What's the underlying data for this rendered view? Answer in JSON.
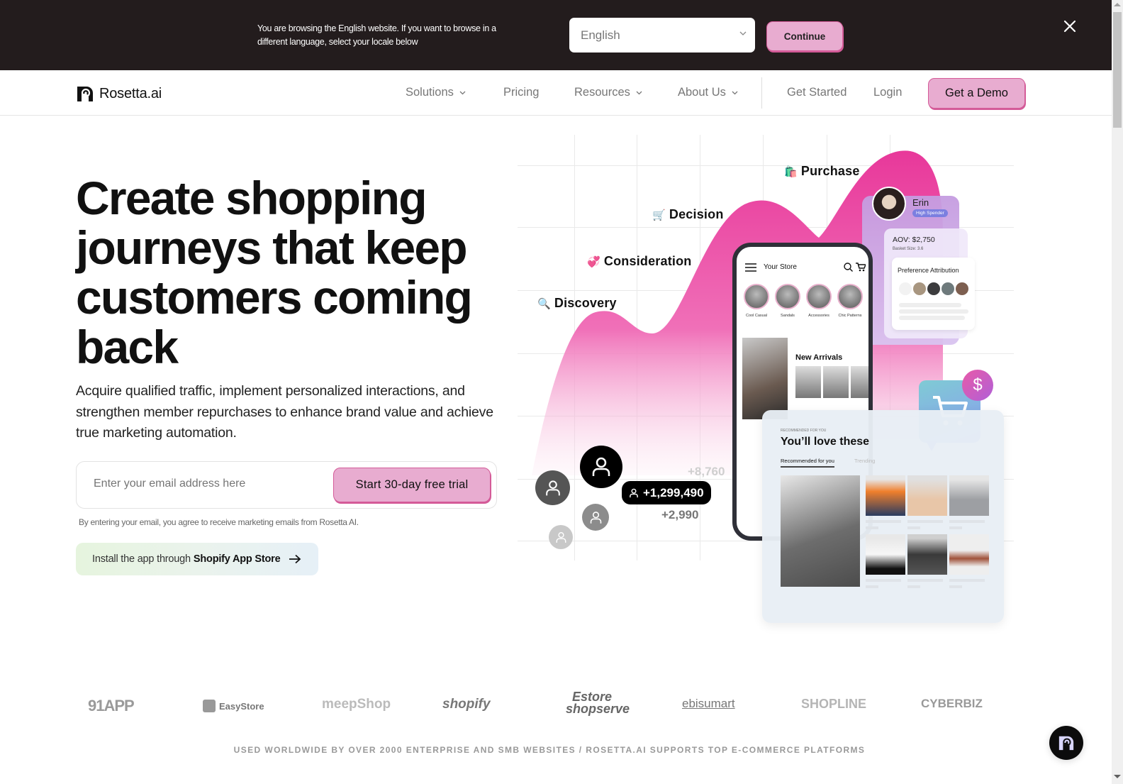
{
  "banner": {
    "message": "You are browsing the English website. If you want to browse in a different language, select your locale below",
    "locale_selected": "English",
    "continue_label": "Continue",
    "close_icon": "close-icon"
  },
  "nav": {
    "brand": "Rosetta.ai",
    "items": [
      {
        "label": "Solutions",
        "has_dropdown": true
      },
      {
        "label": "Pricing",
        "has_dropdown": false
      },
      {
        "label": "Resources",
        "has_dropdown": true
      },
      {
        "label": "About Us",
        "has_dropdown": true
      }
    ],
    "get_started": "Get Started",
    "login": "Login",
    "demo": "Get a Demo"
  },
  "hero": {
    "headline": "Create shopping journeys that keep customers coming back",
    "subtext": "Acquire qualified traffic, implement personalized interactions, and strengthen member repurchases to enhance brand value and achieve true marketing automation.",
    "email_placeholder": "Enter your email address here",
    "trial_label": "Start 30-day free trial",
    "consent": "By entering your email, you agree to receive marketing emails from Rosetta AI.",
    "shopify_prefix": "Install the app through",
    "shopify_link": "Shopify App Store"
  },
  "illustration": {
    "stages": [
      {
        "label": "Discovery",
        "icon": "🔍"
      },
      {
        "label": "Consideration",
        "icon": "💞"
      },
      {
        "label": "Decision",
        "icon": "🛒"
      },
      {
        "label": "Purchase",
        "icon": "🛍️"
      }
    ],
    "phone": {
      "store_title": "Your Store",
      "categories": [
        "Cool Casual",
        "Sandals",
        "Accessories",
        "Chic Patterns"
      ],
      "new_arrivals": "New Arrivals"
    },
    "profile": {
      "name": "Erin",
      "badge": "High Spender",
      "aov": "AOV: $2,750",
      "basket": "Basket Size: 3.6",
      "preference_title": "Preference Attribution",
      "swatches": [
        "#f2f2f2",
        "#a89680",
        "#3c3c3e",
        "#6e7a7c",
        "#7d5f50"
      ]
    },
    "recommendations": {
      "subtitle": "RECOMMENDED FOR YOU",
      "title": "You’ll love these",
      "tabs": [
        "Recommended for you",
        "Trending"
      ]
    },
    "counts": {
      "main": "+1,299,490",
      "faded": "+8,760",
      "secondary": "+2,990"
    },
    "dollar_symbol": "$"
  },
  "platforms": [
    "91APP",
    "EasyStore",
    "meepShop",
    "shopify",
    "Estore shopserve",
    "ebisumart",
    "SHOPLINE",
    "CYBERBIZ"
  ],
  "tagline": "USED WORLDWIDE BY OVER 2000 ENTERPRISE AND SMB WEBSITES / ROSETTA.AI SUPPORTS TOP E-COMMERCE PLATFORMS",
  "colors": {
    "accent_pink": "#e8acd0",
    "accent_border": "#d45b98",
    "banner_bg": "#231c1d"
  }
}
